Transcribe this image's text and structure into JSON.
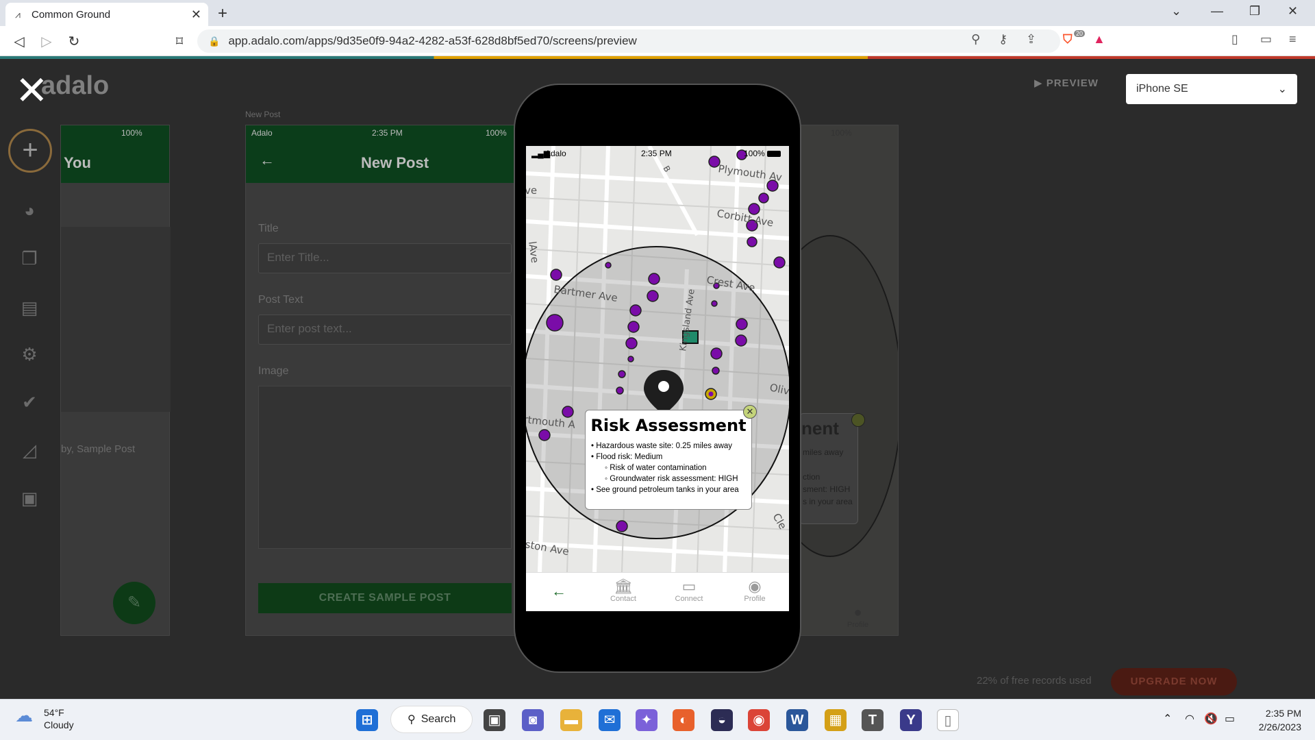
{
  "browser": {
    "tab_title": "Common Ground",
    "url": "app.adalo.com/apps/9d35e0f9-94a2-4282-a53f-628d8bf5ed70/screens/preview",
    "extension_badge": "20"
  },
  "editor": {
    "logo_text": "adalo",
    "preview_label": "PREVIEW",
    "device_selected": "iPhone SE",
    "left_screen": {
      "battery": "100%",
      "title": "You",
      "post_label": "by, Sample Post"
    },
    "mid_screen": {
      "caption": "New Post",
      "carrier": "Adalo",
      "time": "2:35 PM",
      "battery": "100%",
      "title": "New Post",
      "title_label": "Title",
      "title_placeholder": "Enter Title...",
      "post_text_label": "Post Text",
      "post_text_placeholder": "Enter post text...",
      "image_label": "Image",
      "create_button": "CREATE SAMPLE POST"
    },
    "right_screen": {
      "battery": "100%",
      "popup_title": "nent",
      "lines": [
        "miles away",
        "ction",
        "sment: HIGH",
        "s in your area"
      ],
      "profile": "Profile"
    },
    "records_text": "22% of free records used",
    "upgrade_label": "UPGRADE NOW"
  },
  "phone": {
    "carrier": "Adalo",
    "time": "2:35 PM",
    "battery": "100%",
    "streets": [
      "Plymouth Av",
      "Corbitt Ave",
      "Crest Ave",
      "Bartmer Ave",
      "Kingsland Ave",
      "Olive",
      "rtmouth A",
      "ston Ave",
      "Cle",
      "ve",
      "lAve",
      "B"
    ],
    "popup": {
      "title": "Risk Assessment",
      "items": [
        "Hazardous waste site: 0.25 miles away",
        "Flood risk: Medium",
        "Risk of water contamination",
        "Groundwater risk assessment: HIGH",
        "See ground petroleum tanks in your area"
      ]
    },
    "nav": {
      "contact": "Contact",
      "connect": "Connect",
      "profile": "Profile"
    },
    "colors": {
      "marker": "#7a0ca8",
      "site": "#1f8a6a",
      "nav_green": "#1d6b2a"
    }
  },
  "taskbar": {
    "temp": "54°F",
    "condition": "Cloudy",
    "search": "Search",
    "time": "2:35 PM",
    "date": "2/26/2023"
  }
}
